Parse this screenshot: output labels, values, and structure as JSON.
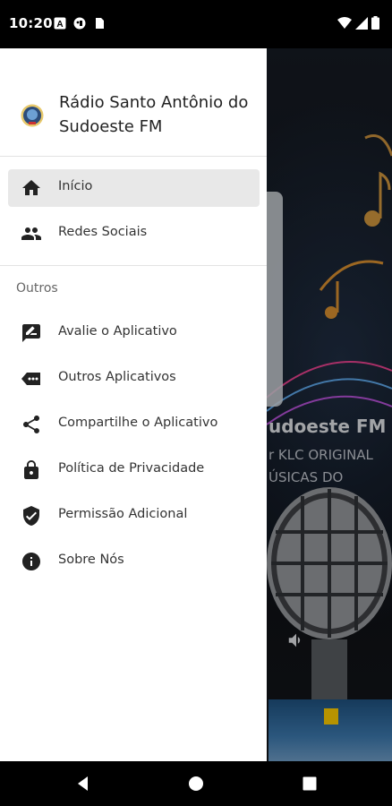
{
  "status_bar": {
    "time": "10:20",
    "left_icons": [
      "a-box-icon",
      "face-icon",
      "sim-card-icon"
    ],
    "right_icons": [
      "wifi-icon",
      "signal-icon",
      "battery-icon"
    ]
  },
  "background_player": {
    "title": "udoeste FM",
    "subtitle_line1": "r KLC ORIGINAL",
    "subtitle_line2": "ÚSICAS DO"
  },
  "drawer": {
    "station_name": "Rádio Santo Antônio do Sudoeste FM",
    "primary_items": [
      {
        "label": "Início",
        "icon": "home-icon",
        "active": true
      },
      {
        "label": "Redes Sociais",
        "icon": "people-icon",
        "active": false
      }
    ],
    "section_title": "Outros",
    "secondary_items": [
      {
        "label": "Avalie o Aplicativo",
        "icon": "rate-review-icon"
      },
      {
        "label": "Outros Aplicativos",
        "icon": "more-apps-icon"
      },
      {
        "label": "Compartilhe o Aplicativo",
        "icon": "share-icon"
      },
      {
        "label": "Política de Privacidade",
        "icon": "lock-icon"
      },
      {
        "label": "Permissão Adicional",
        "icon": "shield-check-icon"
      },
      {
        "label": "Sobre Nós",
        "icon": "info-icon"
      }
    ]
  },
  "nav_bar": {
    "buttons": [
      "back-icon",
      "home-circle-icon",
      "recents-square-icon"
    ]
  },
  "colors": {
    "drawer_bg": "#ffffff",
    "active_item_bg": "#e8e8e8",
    "text_primary": "#333333",
    "section_text": "#666666"
  }
}
